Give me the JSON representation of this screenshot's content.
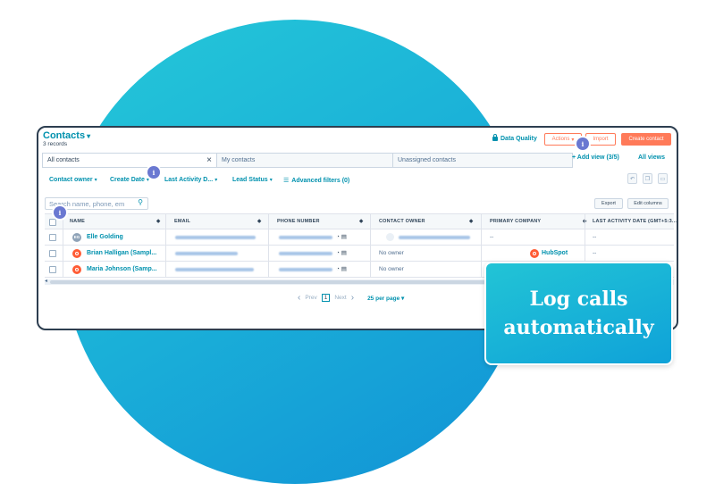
{
  "header": {
    "title": "Contacts",
    "records": "3 records",
    "data_quality": "Data Quality",
    "actions": "Actions",
    "import": "Import",
    "create": "Create contact"
  },
  "tabs": [
    {
      "label": "All contacts",
      "active": true
    },
    {
      "label": "My contacts"
    },
    {
      "label": "Unassigned contacts"
    }
  ],
  "views": {
    "add": "+ Add view (3/5)",
    "all": "All views"
  },
  "filters": [
    {
      "label": "Contact owner"
    },
    {
      "label": "Create Date"
    },
    {
      "label": "Last Activity D..."
    },
    {
      "label": "Lead Status"
    },
    {
      "label": "Advanced filters (0)"
    }
  ],
  "search": {
    "placeholder": "Search name, phone, em"
  },
  "table_actions": {
    "export": "Export",
    "edit_columns": "Edit columns"
  },
  "columns": [
    "NAME",
    "EMAIL",
    "PHONE NUMBER",
    "CONTACT OWNER",
    "PRIMARY COMPANY",
    "LAST ACTIVITY DATE (GMT+5:3..."
  ],
  "rows": [
    {
      "initials": "EG",
      "name": "Elle Golding",
      "owner": "",
      "company": "--",
      "last_activity": "--"
    },
    {
      "initials": "",
      "name": "Brian Halligan (Sampl...",
      "owner": "No owner",
      "company": "HubSpot",
      "last_activity": "--"
    },
    {
      "initials": "",
      "name": "Maria Johnson (Samp...",
      "owner": "No owner",
      "company": "",
      "last_activity": ""
    }
  ],
  "pager": {
    "prev": "Prev",
    "page": "1",
    "next": "Next",
    "per_page": "25 per page"
  },
  "badge_glyph": "i",
  "callout": "Log calls automatically",
  "colors": {
    "accent": "#0091ae",
    "orange": "#ff7a59",
    "badge": "#6a78d1",
    "circle": "#1bb2d8"
  }
}
